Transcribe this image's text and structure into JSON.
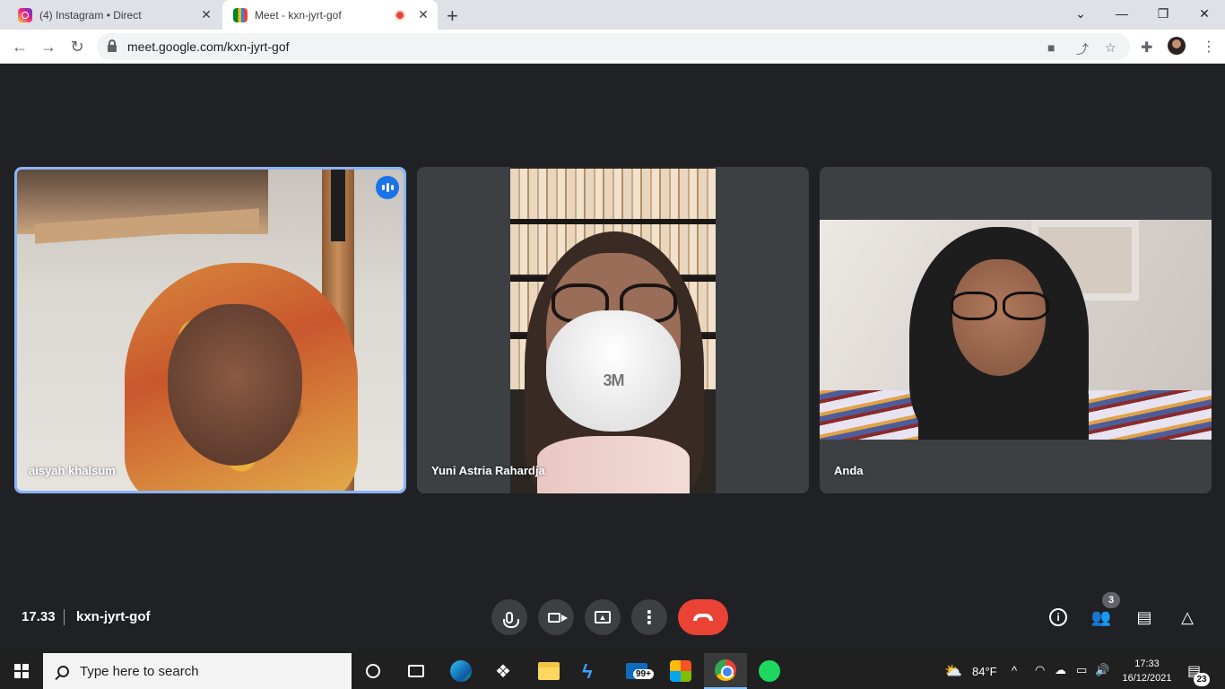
{
  "browser": {
    "tabs": [
      {
        "title": "(4) Instagram • Direct",
        "close": "✕"
      },
      {
        "title": "Meet - kxn-jyrt-gof",
        "close": "✕"
      }
    ],
    "new_tab": "+",
    "window_controls": {
      "dropdown": "⌄",
      "minimize": "—",
      "restore": "❐",
      "close": "✕"
    },
    "url": "meet.google.com/kxn-jyrt-gof",
    "nav": {
      "back": "←",
      "forward": "→",
      "reload": "↻"
    },
    "toolbar_icons": {
      "camera": "■",
      "share": "⤴",
      "star": "☆",
      "extensions": "✚",
      "menu": "⋮"
    }
  },
  "meet": {
    "participants": [
      {
        "name": "aisyah khalsum"
      },
      {
        "name": "Yuni Astria Rahardja"
      },
      {
        "name": "Anda"
      }
    ],
    "mask_text": "3M",
    "time": "17.33",
    "meeting_code": "kxn-jyrt-gof",
    "controls": {
      "more": "⋮"
    },
    "right_icons": {
      "info": "i",
      "people": "👥",
      "chat": "▤",
      "activities": "△"
    },
    "people_count": "3"
  },
  "taskbar": {
    "search_placeholder": "Type here to search",
    "weather": "84°F",
    "mail_badge": "99+",
    "clock_time": "17:33",
    "clock_date": "16/12/2021",
    "notification_count": "23",
    "tray": {
      "chevron": "^",
      "wifi": "◠",
      "cloud": "☁",
      "battery": "▭",
      "volume": "🔊",
      "notif": "▤",
      "weather_icon": "⛅"
    }
  },
  "colors": {
    "active_speaker": "#8ab4f8",
    "end_call": "#ea4335",
    "meet_bg": "#202124",
    "tile_bg": "#3c4043"
  }
}
